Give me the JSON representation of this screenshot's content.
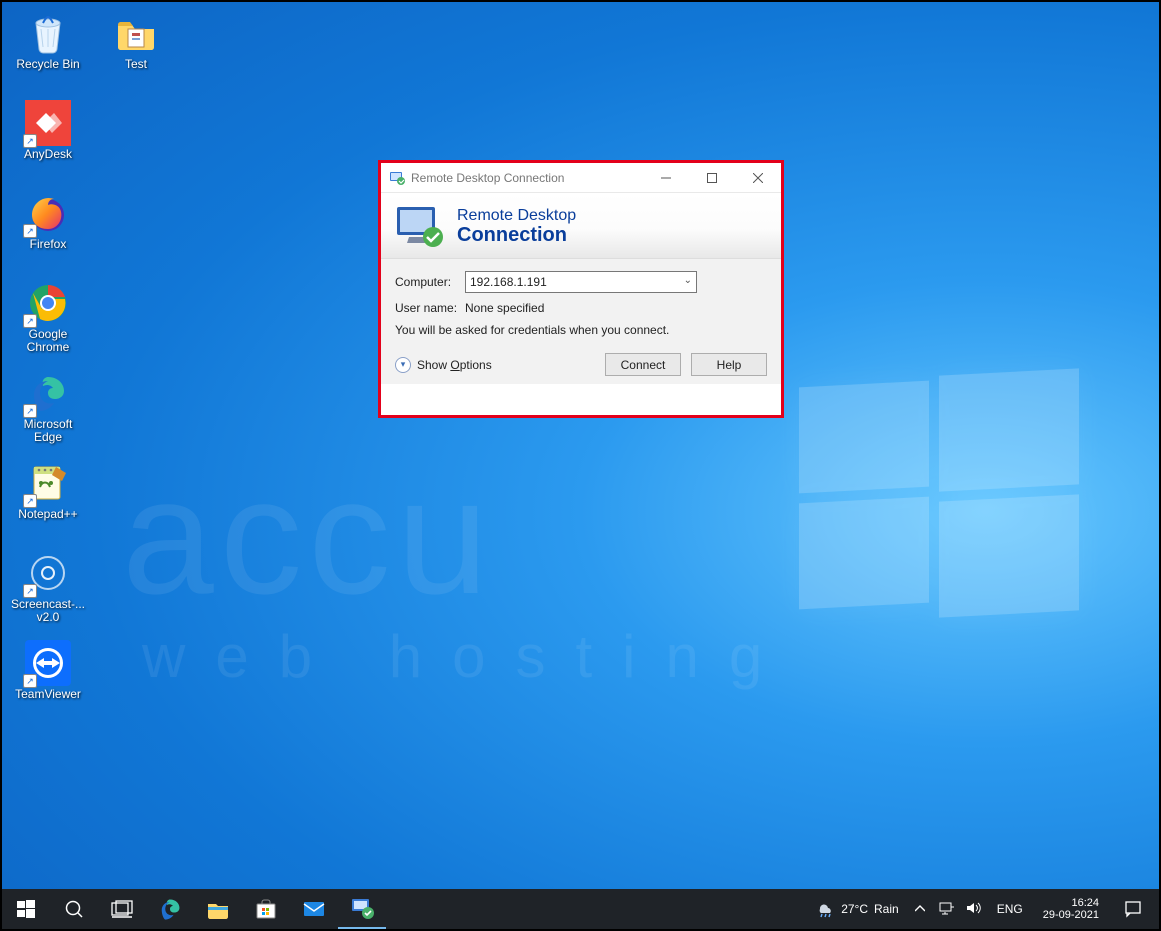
{
  "desktop_icons_col1": [
    {
      "name": "recycle-bin",
      "label": "Recycle Bin",
      "shortcut": false
    },
    {
      "name": "anydesk",
      "label": "AnyDesk",
      "shortcut": true
    },
    {
      "name": "firefox",
      "label": "Firefox",
      "shortcut": true
    },
    {
      "name": "google-chrome",
      "label": "Google Chrome",
      "shortcut": true
    },
    {
      "name": "microsoft-edge",
      "label": "Microsoft Edge",
      "shortcut": true
    },
    {
      "name": "notepad-pp",
      "label": "Notepad++",
      "shortcut": true
    },
    {
      "name": "screencast",
      "label": "Screencast-... v2.0",
      "shortcut": true
    },
    {
      "name": "teamviewer",
      "label": "TeamViewer",
      "shortcut": true
    }
  ],
  "desktop_icons_col2": [
    {
      "name": "test-folder",
      "label": "Test",
      "shortcut": false
    }
  ],
  "watermark": {
    "line1": "accu",
    "line2": "web hosting"
  },
  "rdp": {
    "title": "Remote Desktop Connection",
    "banner_line1": "Remote Desktop",
    "banner_line2": "Connection",
    "computer_label": "Computer:",
    "computer_value": "192.168.1.191",
    "username_label": "User name:",
    "username_value": "None specified",
    "hint": "You will be asked for credentials when you connect.",
    "show_options": "Show Options",
    "connect": "Connect",
    "help": "Help"
  },
  "taskbar": {
    "weather_temp": "27°C",
    "weather_cond": "Rain",
    "lang": "ENG",
    "time": "16:24",
    "date": "29-09-2021"
  }
}
